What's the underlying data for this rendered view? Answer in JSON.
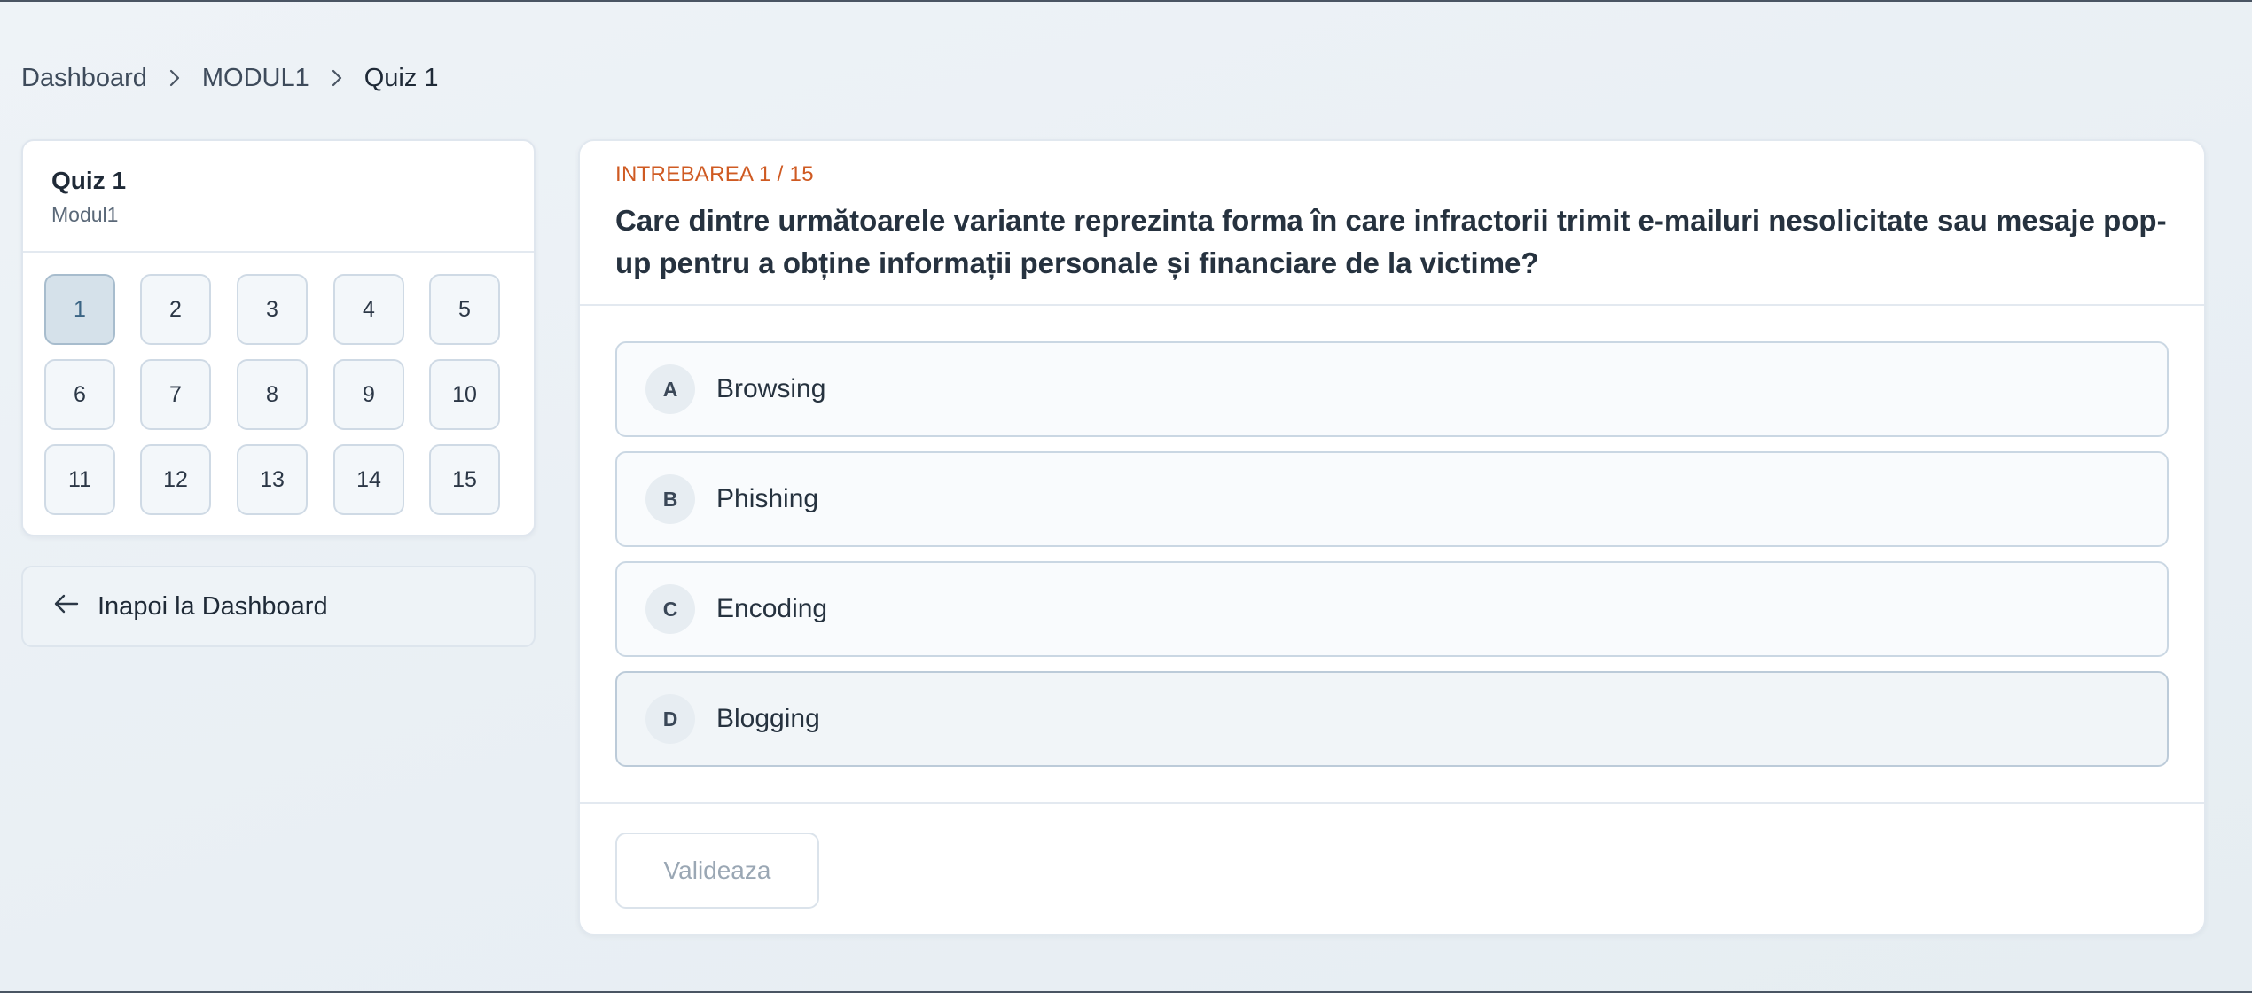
{
  "breadcrumb": {
    "items": [
      {
        "label": "Dashboard"
      },
      {
        "label": "MODUL1"
      },
      {
        "label": "Quiz 1"
      }
    ]
  },
  "sidebar": {
    "quiz_title": "Quiz 1",
    "quiz_module": "Modul1",
    "questions": [
      "1",
      "2",
      "3",
      "4",
      "5",
      "6",
      "7",
      "8",
      "9",
      "10",
      "11",
      "12",
      "13",
      "14",
      "15"
    ],
    "active_question": "1",
    "back_label": "Inapoi la Dashboard",
    "back_icon": "arrow-left-icon"
  },
  "question": {
    "counter": "INTREBAREA 1 / 15",
    "text": "Care dintre următoarele variante reprezinta forma în care infractorii trimit e-mailuri nesolicitate sau mesaje pop-up pentru a obține informații personale și financiare de la victime?",
    "options": [
      {
        "letter": "A",
        "text": "Browsing"
      },
      {
        "letter": "B",
        "text": "Phishing"
      },
      {
        "letter": "C",
        "text": "Encoding"
      },
      {
        "letter": "D",
        "text": "Blogging"
      }
    ],
    "validate_label": "Valideaza"
  },
  "colors": {
    "accent_counter": "#cf5a22",
    "active_question_bg": "#d5e1ea"
  }
}
